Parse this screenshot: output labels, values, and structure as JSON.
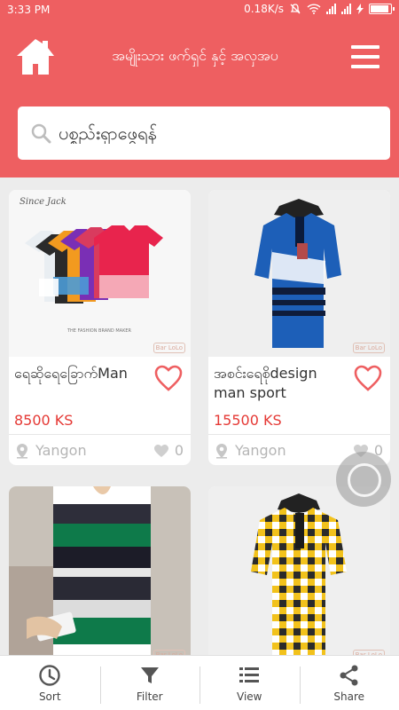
{
  "status_bar": {
    "time": "3:33 PM",
    "network_speed": "0.18K/s"
  },
  "header": {
    "title": "အမျိုးသား ဖက်ရှင် နှင့် အလှအပ",
    "home_icon": "home-icon",
    "menu_icon": "hamburger-menu-icon"
  },
  "search": {
    "placeholder": "ပစ္စည်းရှာဖွေရန်"
  },
  "products": [
    {
      "name": "ရေဆိုရေခြောက်Man",
      "price": "8500 KS",
      "location": "Yangon",
      "likes": "0",
      "stamp": "Bar LoLo",
      "image_caption": "Since Jack"
    },
    {
      "name": "အစင်းရေစိုdesign man sport",
      "price": "15500 KS",
      "location": "Yangon",
      "likes": "0",
      "stamp": "Bar LoLo"
    },
    {
      "stamp": "Bar LoLo"
    },
    {
      "stamp": "Bar LoLo"
    }
  ],
  "bottom_nav": {
    "items": [
      {
        "label": "Sort",
        "icon": "clock-icon"
      },
      {
        "label": "Filter",
        "icon": "filter-icon"
      },
      {
        "label": "View",
        "icon": "list-view-icon"
      },
      {
        "label": "Share",
        "icon": "share-icon"
      }
    ]
  },
  "colors": {
    "brand": "#ee5f61",
    "price": "#e53935",
    "muted": "#b5b5b5"
  }
}
